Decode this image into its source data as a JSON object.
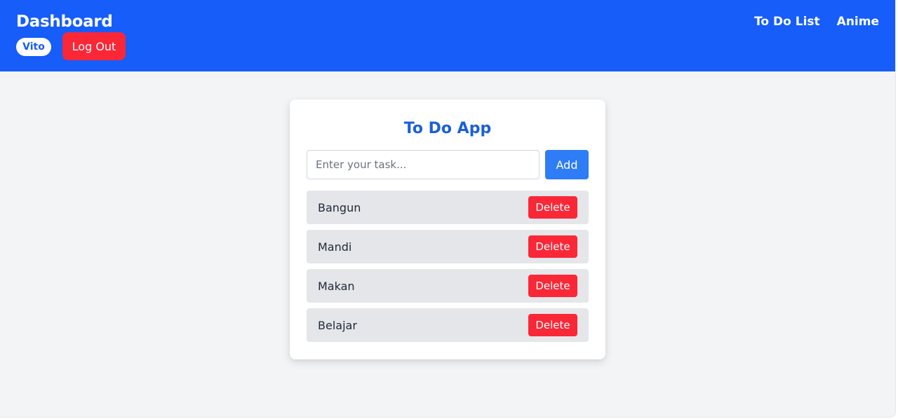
{
  "navbar": {
    "title": "Dashboard",
    "user_name": "Vito",
    "logout_label": "Log Out",
    "links": [
      "To Do List",
      "Anime"
    ]
  },
  "todo": {
    "title": "To Do App",
    "input_placeholder": "Enter your task...",
    "input_value": "",
    "add_label": "Add",
    "tasks": [
      {
        "text": "Bangun",
        "delete_label": "Delete"
      },
      {
        "text": "Mandi",
        "delete_label": "Delete"
      },
      {
        "text": "Makan",
        "delete_label": "Delete"
      },
      {
        "text": "Belajar",
        "delete_label": "Delete"
      }
    ]
  },
  "colors": {
    "primary": "#165df9",
    "danger": "#fa2737",
    "accent_button": "#2e7cf6",
    "title_text": "#1a5fdb",
    "background": "#f3f4f6",
    "task_background": "#e5e6ea"
  }
}
